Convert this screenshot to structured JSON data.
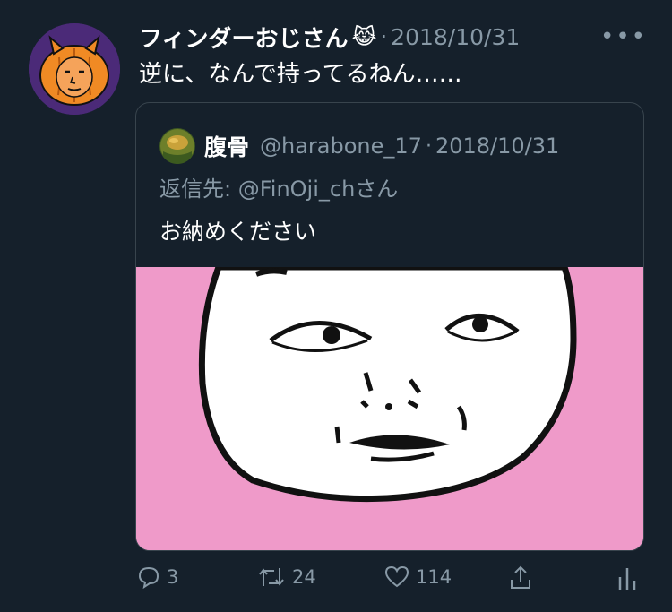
{
  "tweet": {
    "display_name": "フィンダーおじさん",
    "name_emoji": "😹",
    "separator": "·",
    "date": "2018/10/31",
    "more_label": "•••",
    "text": "逆に、なんで持ってるねん……"
  },
  "quote": {
    "display_name": "腹骨",
    "handle": "@harabone_17",
    "separator": "·",
    "date": "2018/10/31",
    "reply_to": "返信先: @FinOji_chさん",
    "text": "お納めください"
  },
  "actions": {
    "reply_count": "3",
    "retweet_count": "24",
    "like_count": "114"
  },
  "icons": {
    "reply": "speech-bubble-icon",
    "retweet": "retweet-arrows-icon",
    "like": "heart-icon",
    "share": "share-upload-icon",
    "analytics": "bar-chart-icon"
  },
  "colors": {
    "background": "#15202b",
    "secondary_text": "#8899a6",
    "border": "#38444d",
    "image_background": "#ef9ac9",
    "avatar_background": "#4b2a78"
  }
}
